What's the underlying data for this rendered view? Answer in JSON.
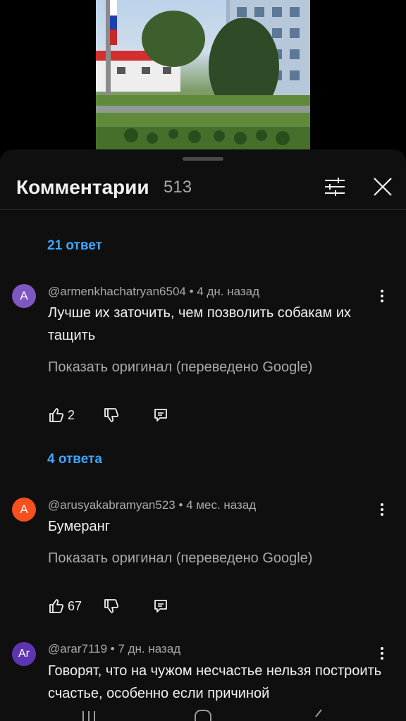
{
  "comments_panel": {
    "title": "Комментарии",
    "count": "513"
  },
  "threads": [
    {
      "replies_label": "21 ответ"
    },
    {
      "avatar_letter": "A",
      "avatar_color": "#7e57c2",
      "meta": "@armenkhachatryan6504 • 4 дн. назад",
      "text": "Лучше их заточить, чем позволить собакам их тащить",
      "translate_label": "Показать оригинал (переведено Google)",
      "likes": "2",
      "replies_label": "4 ответа"
    },
    {
      "avatar_letter": "A",
      "avatar_color": "#f4511e",
      "meta": "@arusyakabramyan523 • 4 мес. назад",
      "text": "Бумеранг",
      "translate_label": "Показать оригинал (переведено Google)",
      "likes": "67"
    },
    {
      "avatar_letter": "Ar",
      "avatar_color": "#5e35b1",
      "meta": "@arar7119 • 7 дн. назад",
      "text": "Говорят, что на чужом несчастье нельзя построить счастье, особенно если причиной"
    }
  ],
  "colors": {
    "accent_link": "#3ea6ff",
    "panel_bg": "#0f0f0f",
    "secondary_text": "#aaaaaa"
  }
}
